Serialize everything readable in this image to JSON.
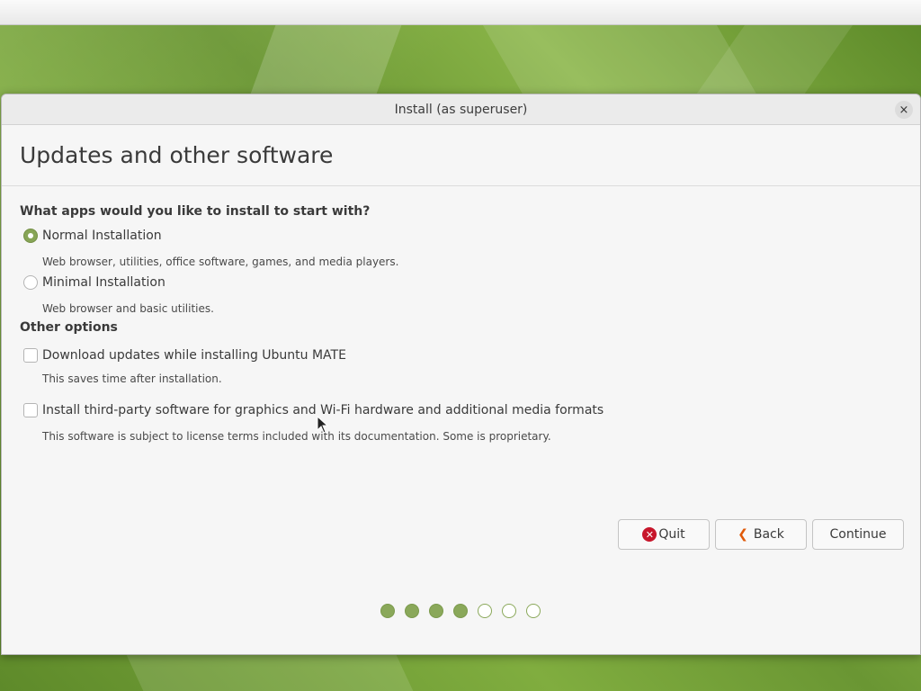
{
  "window": {
    "title": "Install (as superuser)",
    "close_glyph": "×"
  },
  "page": {
    "title": "Updates and other software"
  },
  "apps_section": {
    "label": "What apps would you like to install to start with?",
    "options": [
      {
        "label": "Normal Installation",
        "description": "Web browser, utilities, office software, games, and media players.",
        "selected": true
      },
      {
        "label": "Minimal Installation",
        "description": "Web browser and basic utilities.",
        "selected": false
      }
    ]
  },
  "other_section": {
    "label": "Other options",
    "options": [
      {
        "label": "Download updates while installing Ubuntu MATE",
        "description": "This saves time after installation.",
        "checked": false
      },
      {
        "label": "Install third-party software for graphics and Wi-Fi hardware and additional media formats",
        "description": "This software is subject to license terms included with its documentation. Some is proprietary.",
        "checked": false
      }
    ]
  },
  "buttons": {
    "quit": {
      "label": "Quit",
      "icon": "quit-icon",
      "icon_glyph": "✕"
    },
    "back": {
      "label": "Back",
      "icon": "back-arrow-icon",
      "icon_glyph": "❮"
    },
    "continue": {
      "label": "Continue"
    }
  },
  "progress": {
    "total_steps": 7,
    "completed_steps": 4
  },
  "colors": {
    "accent": "#87a556",
    "quit_icon": "#c7162b",
    "back_icon": "#e05a0a"
  }
}
